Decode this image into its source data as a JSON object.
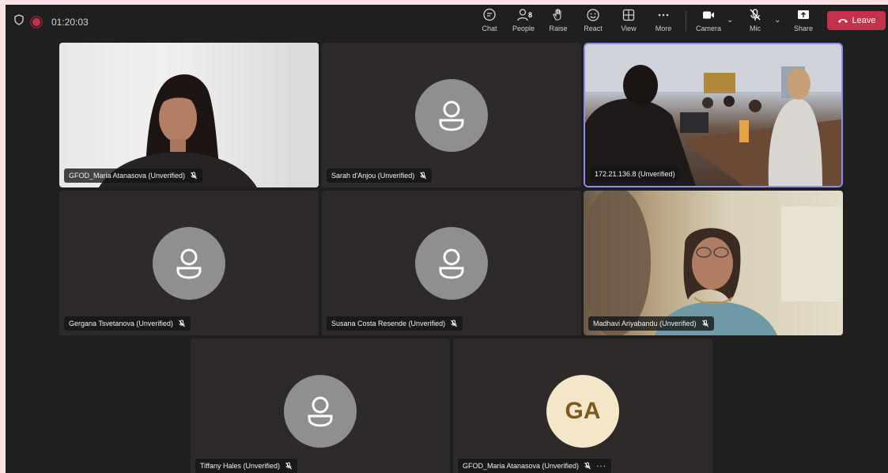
{
  "topbar": {
    "timer": "01:20:03",
    "chat_label": "Chat",
    "people_label": "People",
    "people_count": "8",
    "raise_label": "Raise",
    "react_label": "React",
    "view_label": "View",
    "more_label": "More",
    "camera_label": "Camera",
    "mic_label": "Mic",
    "share_label": "Share",
    "leave_label": "Leave"
  },
  "participants": [
    {
      "name": "GFOD_Maria Atanasova (Unverified)",
      "has_video": true
    },
    {
      "name": "Sarah d'Anjou (Unverified)",
      "has_video": false
    },
    {
      "name": "172.21.136.8 (Unverified)",
      "has_video": true,
      "active_speaker": true
    },
    {
      "name": "Gergana Tsvetanova (Unverified)",
      "has_video": false
    },
    {
      "name": "Susana Costa Resende (Unverified)",
      "has_video": false
    },
    {
      "name": "Madhavi Ariyabandu (Unverified)",
      "has_video": true
    },
    {
      "name": "Tiffany Hales (Unverified)",
      "has_video": false
    },
    {
      "name": "GFOD_Maria Atanasova (Unverified)",
      "has_video": false,
      "initials": "GA"
    }
  ],
  "colors": {
    "leave": "#c4314b",
    "active_border": "#8b8df0",
    "tile_bg": "#2d2a29",
    "avatar_bg": "#8f8f8f",
    "initials_bg": "#f4e6c8"
  }
}
